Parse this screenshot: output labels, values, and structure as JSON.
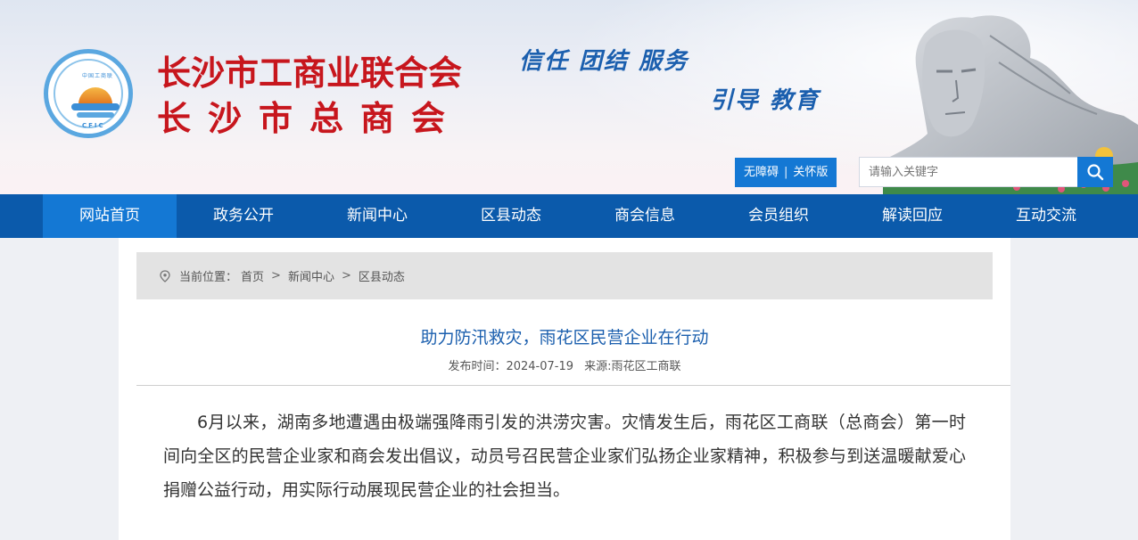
{
  "header": {
    "logo_text_top": "中国工商联",
    "logo_text_bottom": "CFIC",
    "title_line1": "长沙市工商业联合会",
    "title_line2": "长沙市总商会",
    "slogan_line1": "信任 团结 服务",
    "slogan_line2": "引导 教育",
    "accessibility_label": "无障碍",
    "care_label": "关怀版",
    "separator": "|",
    "search_placeholder": "请输入关键字",
    "search_icon": "search-icon"
  },
  "nav": {
    "items": [
      {
        "label": "网站首页",
        "active": true
      },
      {
        "label": "政务公开",
        "active": false
      },
      {
        "label": "新闻中心",
        "active": false
      },
      {
        "label": "区县动态",
        "active": false
      },
      {
        "label": "商会信息",
        "active": false
      },
      {
        "label": "会员组织",
        "active": false
      },
      {
        "label": "解读回应",
        "active": false
      },
      {
        "label": "互动交流",
        "active": false
      }
    ]
  },
  "breadcrumb": {
    "prefix": "当前位置：",
    "items": [
      "首页",
      "新闻中心",
      "区县动态"
    ],
    "separator": ">",
    "icon": "location-pin-icon"
  },
  "article": {
    "title": "助力防汛救灾，雨花区民营企业在行动",
    "publish_time": "发布时间：2024-07-19",
    "source": "来源:雨花区工商联",
    "body": "6月以来，湖南多地遭遇由极端强降雨引发的洪涝灾害。灾情发生后，雨花区工商联（总商会）第一时间向全区的民营企业家和商会发出倡议，动员号召民营企业家们弘扬企业家精神，积极参与到送温暖献爱心捐赠公益行动，用实际行动展现民营企业的社会担当。"
  },
  "colors": {
    "nav_bg": "#0b5aab",
    "nav_active": "#1478d4",
    "title_red": "#c7161d",
    "slogan_blue": "#1b5fae"
  }
}
